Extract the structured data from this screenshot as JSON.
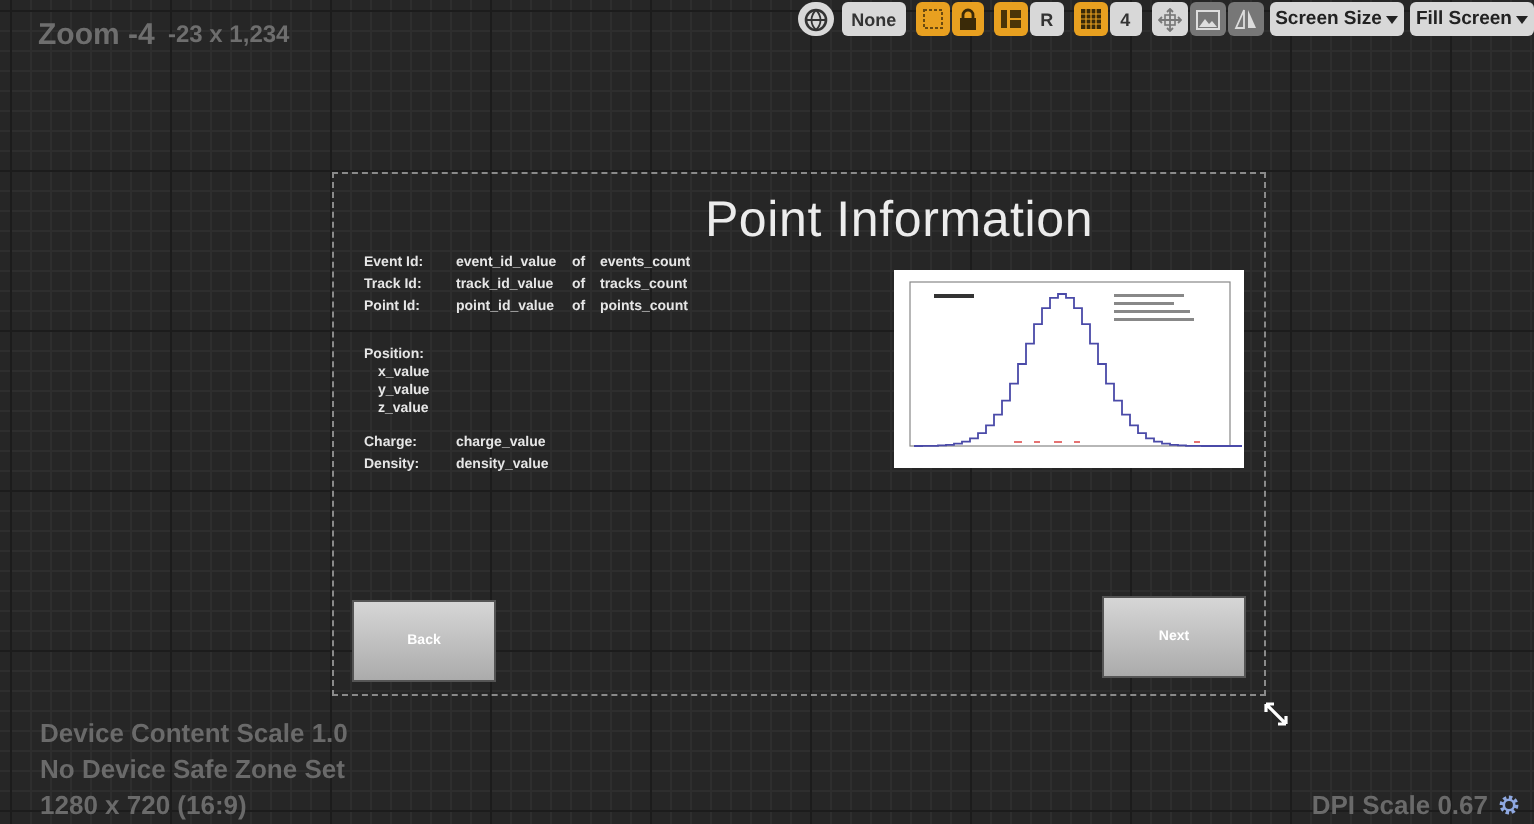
{
  "viewport": {
    "zoom": "Zoom -4",
    "coords": "-23 x 1,234"
  },
  "toolbar": [
    {
      "kind": "globe",
      "on": false,
      "disabled": false
    },
    {
      "kind": "text",
      "label": "None",
      "on": false,
      "disabled": false
    },
    {
      "kind": "outline",
      "on": true,
      "disabled": false
    },
    {
      "kind": "lock",
      "on": true,
      "disabled": false
    },
    {
      "kind": "layout",
      "on": true,
      "disabled": false
    },
    {
      "kind": "text",
      "label": "R",
      "on": false,
      "disabled": false
    },
    {
      "kind": "grid",
      "on": true,
      "disabled": false
    },
    {
      "kind": "text",
      "label": "4",
      "on": false,
      "disabled": false
    },
    {
      "kind": "move",
      "on": false,
      "disabled": false
    },
    {
      "kind": "image",
      "on": false,
      "disabled": true
    },
    {
      "kind": "mirror",
      "on": false,
      "disabled": true
    }
  ],
  "dropdowns": [
    "Screen Size",
    "Fill Screen"
  ],
  "widget": {
    "title": "Point Information",
    "ids": [
      {
        "label": "Event Id:",
        "value": "event_id_value",
        "of": "of",
        "count": "events_count"
      },
      {
        "label": "Track Id:",
        "value": "track_id_value",
        "of": "of",
        "count": "tracks_count"
      },
      {
        "label": "Point Id:",
        "value": "point_id_value",
        "of": "of",
        "count": "points_count"
      }
    ],
    "position": {
      "label": "Position:",
      "values": [
        "x_value",
        "y_value",
        "z_value"
      ]
    },
    "fields": [
      {
        "label": "Charge:",
        "value": "charge_value"
      },
      {
        "label": "Density:",
        "value": "density_value"
      }
    ],
    "buttons": [
      {
        "label": "Back"
      },
      {
        "label": "Next"
      }
    ]
  },
  "info": [
    "Device Content Scale 1.0",
    "No Device Safe Zone Set",
    "1280 x 720 (16:9)"
  ],
  "dpi": "DPI Scale 0.67"
}
